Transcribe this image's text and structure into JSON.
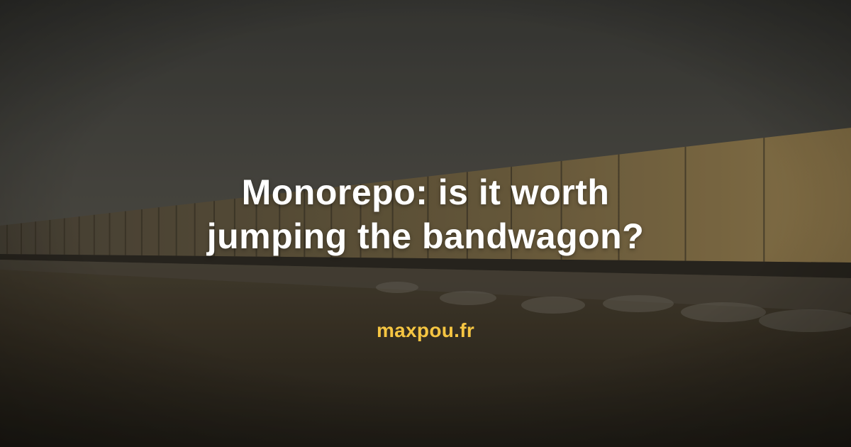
{
  "title_lines": [
    "Monorepo: is it worth",
    "jumping the bandwagon?"
  ],
  "site": "maxpou.fr",
  "colors": {
    "title": "#ffffff",
    "site": "#f5c542",
    "sky": "#3a3a36",
    "train": "#8a7346",
    "ground": "#3b3326"
  },
  "background": {
    "subject": "freight train boxcars under hazy sky"
  }
}
